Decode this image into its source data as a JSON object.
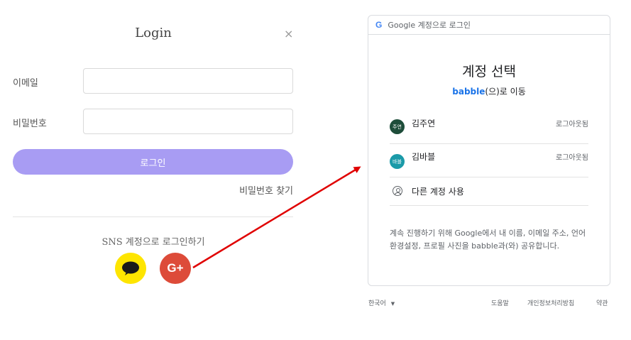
{
  "login": {
    "title": "Login",
    "close_glyph": "×",
    "email_label": "이메일",
    "email_value": "",
    "password_label": "비밀번호",
    "password_value": "",
    "login_button": "로그인",
    "find_password": "비밀번호 찾기",
    "sns_text": "SNS 계정으로 로그인하기",
    "google_glyph": "G+",
    "icons": [
      "close-icon",
      "kakao-talk-icon",
      "google-plus-icon"
    ]
  },
  "google_chooser": {
    "header_logo": "G",
    "header_text": "Google 계정으로 로그인",
    "title": "계정 선택",
    "subtitle_app": "babble",
    "subtitle_rest": "(으)로 이동",
    "accounts": [
      {
        "avatar": "주연",
        "name": "김주연",
        "status": "로그아웃됨",
        "color": "#1e4d3a"
      },
      {
        "avatar": "바블",
        "name": "김바블",
        "status": "로그아웃됨",
        "color": "#1b9aa8"
      }
    ],
    "other_account": "다른 계정 사용",
    "notice": "계속 진행하기 위해 Google에서 내 이름, 이메일 주소, 언어 환경설정, 프로필 사진을 babble과(와) 공유합니다.",
    "footer": {
      "language": "한국어",
      "help": "도움말",
      "privacy": "개인정보처리방침",
      "terms": "약관"
    }
  },
  "colors": {
    "login_button": "#a89cf3",
    "kakao": "#fee500",
    "google_plus": "#dd4b39",
    "arrow": "#e00000",
    "google_blue": "#1a73e8"
  }
}
